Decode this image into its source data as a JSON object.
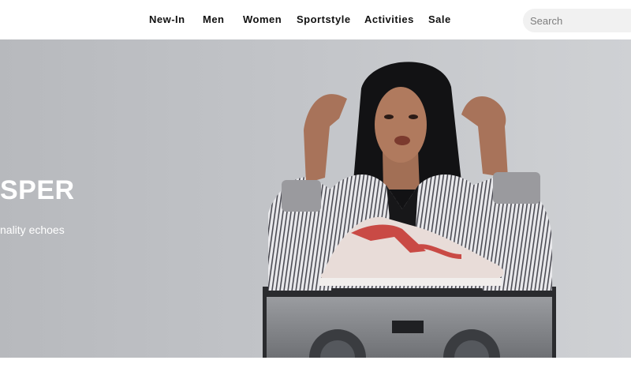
{
  "nav": {
    "items": [
      {
        "label": "New-In"
      },
      {
        "label": "Men"
      },
      {
        "label": "Women"
      },
      {
        "label": "Sportstyle"
      },
      {
        "label": "Activities"
      },
      {
        "label": "Sale"
      }
    ]
  },
  "search": {
    "placeholder": "Search",
    "value": ""
  },
  "hero": {
    "title": "SPER",
    "subtitle": "nality echoes",
    "colors": {
      "background": "#c2c4c8",
      "text": "#ffffff"
    }
  }
}
